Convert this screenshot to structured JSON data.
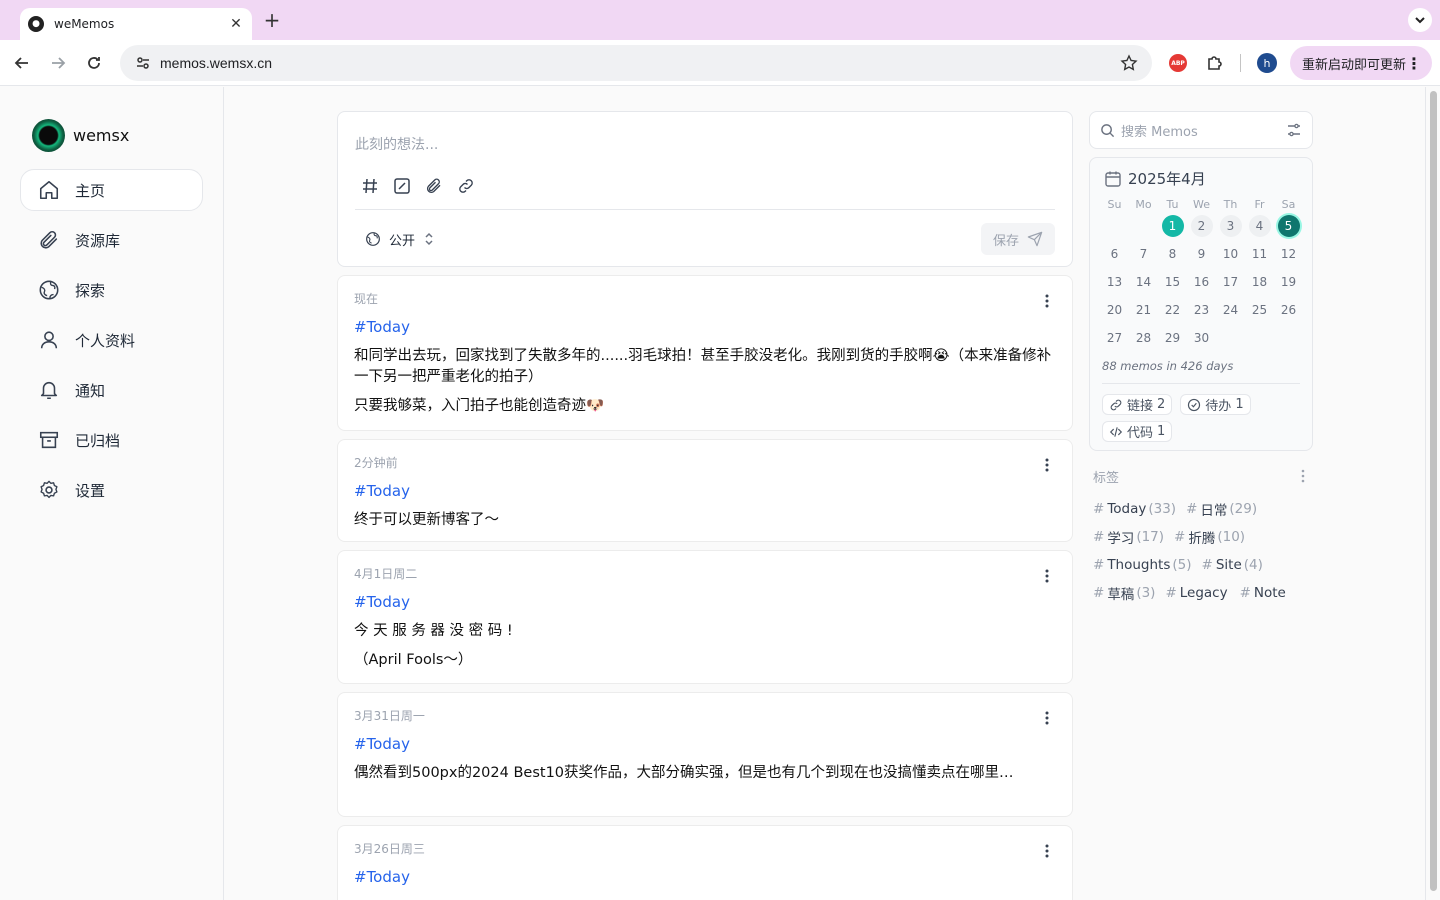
{
  "browser": {
    "tab_title": "weMemos",
    "url": "memos.wemsx.cn",
    "update_label": "重新启动即可更新",
    "profile_initial": "h",
    "abp_label": "ABP"
  },
  "sidebar": {
    "brand_name": "wemsx",
    "items": [
      {
        "label": "主页",
        "icon": "home-icon"
      },
      {
        "label": "资源库",
        "icon": "paperclip-icon"
      },
      {
        "label": "探索",
        "icon": "globe-icon"
      },
      {
        "label": "个人资料",
        "icon": "user-icon"
      },
      {
        "label": "通知",
        "icon": "bell-icon"
      },
      {
        "label": "已归档",
        "icon": "archive-icon"
      },
      {
        "label": "设置",
        "icon": "gear-icon"
      }
    ]
  },
  "editor": {
    "placeholder": "此刻的想法...",
    "visibility": "公开",
    "save_label": "保存"
  },
  "memos": [
    {
      "time": "现在",
      "tag": "#Today",
      "paragraphs": [
        "和同学出去玩，回家找到了失散多年的......羽毛球拍！甚至手胶没老化。我刚到货的手胶啊😭（本来准备修补一下另一把严重老化的拍子）",
        "只要我够菜，入门拍子也能创造奇迹🐶"
      ]
    },
    {
      "time": "2分钟前",
      "tag": "#Today",
      "paragraphs": [
        "终于可以更新博客了～"
      ]
    },
    {
      "time": "4月1日周二",
      "tag": "#Today",
      "paragraphs": [
        "今 天 服 务 器 没 密 码 !",
        "（April Fools～）"
      ]
    },
    {
      "time": "3月31日周一",
      "tag": "#Today",
      "paragraphs": [
        "偶然看到500px的2024 Best10获奖作品，大部分确实强，但是也有几个到现在也没搞懂卖点在哪里…"
      ]
    },
    {
      "time": "3月26日周三",
      "tag": "#Today",
      "paragraphs": []
    }
  ],
  "search": {
    "placeholder": "搜索 Memos"
  },
  "calendar": {
    "month": "2025年4月",
    "weekdays": [
      "Su",
      "Mo",
      "Tu",
      "We",
      "Th",
      "Fr",
      "Sa"
    ],
    "weeks": [
      [
        "",
        "",
        "1",
        "2",
        "3",
        "4",
        "5"
      ],
      [
        "6",
        "7",
        "8",
        "9",
        "10",
        "11",
        "12"
      ],
      [
        "13",
        "14",
        "15",
        "16",
        "17",
        "18",
        "19"
      ],
      [
        "20",
        "21",
        "22",
        "23",
        "24",
        "25",
        "26"
      ],
      [
        "27",
        "28",
        "29",
        "30",
        "",
        "",
        ""
      ]
    ],
    "summary": "88 memos in 426 days",
    "stats": [
      {
        "label": "链接",
        "count": "2",
        "icon": "link-icon"
      },
      {
        "label": "待办",
        "count": "1",
        "icon": "check-circle-icon"
      },
      {
        "label": "代码",
        "count": "1",
        "icon": "code-icon"
      }
    ]
  },
  "tags_section": {
    "title": "标签",
    "tags": [
      {
        "name": "Today",
        "count": "(33)"
      },
      {
        "name": "日常",
        "count": "(29)"
      },
      {
        "name": "学习",
        "count": "(17)"
      },
      {
        "name": "折腾",
        "count": "(10)"
      },
      {
        "name": "Thoughts",
        "count": "(5)"
      },
      {
        "name": "Site",
        "count": "(4)"
      },
      {
        "name": "草稿",
        "count": "(3)"
      },
      {
        "name": "Legacy",
        "count": ""
      },
      {
        "name": "Note",
        "count": ""
      }
    ]
  },
  "colors": {
    "accent": "#14b8a6",
    "tag_link": "#2563eb",
    "chrome": "#f1d8f4"
  }
}
